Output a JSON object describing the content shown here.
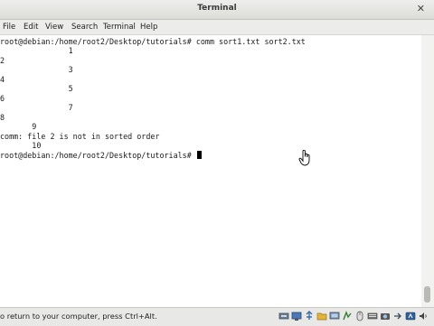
{
  "window": {
    "title": "Terminal"
  },
  "menu": [
    "File",
    "Edit",
    "View",
    "Search",
    "Terminal",
    "Help"
  ],
  "terminal": {
    "lines": [
      "root@debian:/home/root2/Desktop/tutorials# comm sort1.txt sort2.txt",
      "               1",
      "2",
      "               3",
      "4",
      "               5",
      "6",
      "               7",
      "8",
      "       9",
      "comm: file 2 is not in sorted order",
      "       10",
      "root@debian:/home/root2/Desktop/tutorials# "
    ]
  },
  "status": {
    "hint": "o return to your computer, press Ctrl+Alt."
  },
  "tray_icons": [
    "network-icon",
    "display-icon",
    "usb-icon",
    "folder-icon",
    "monitor-icon",
    "share-icon",
    "mouse-icon",
    "keyboard-icon",
    "camera-icon",
    "arrow-icon",
    "host-key-icon",
    "audio-icon"
  ]
}
